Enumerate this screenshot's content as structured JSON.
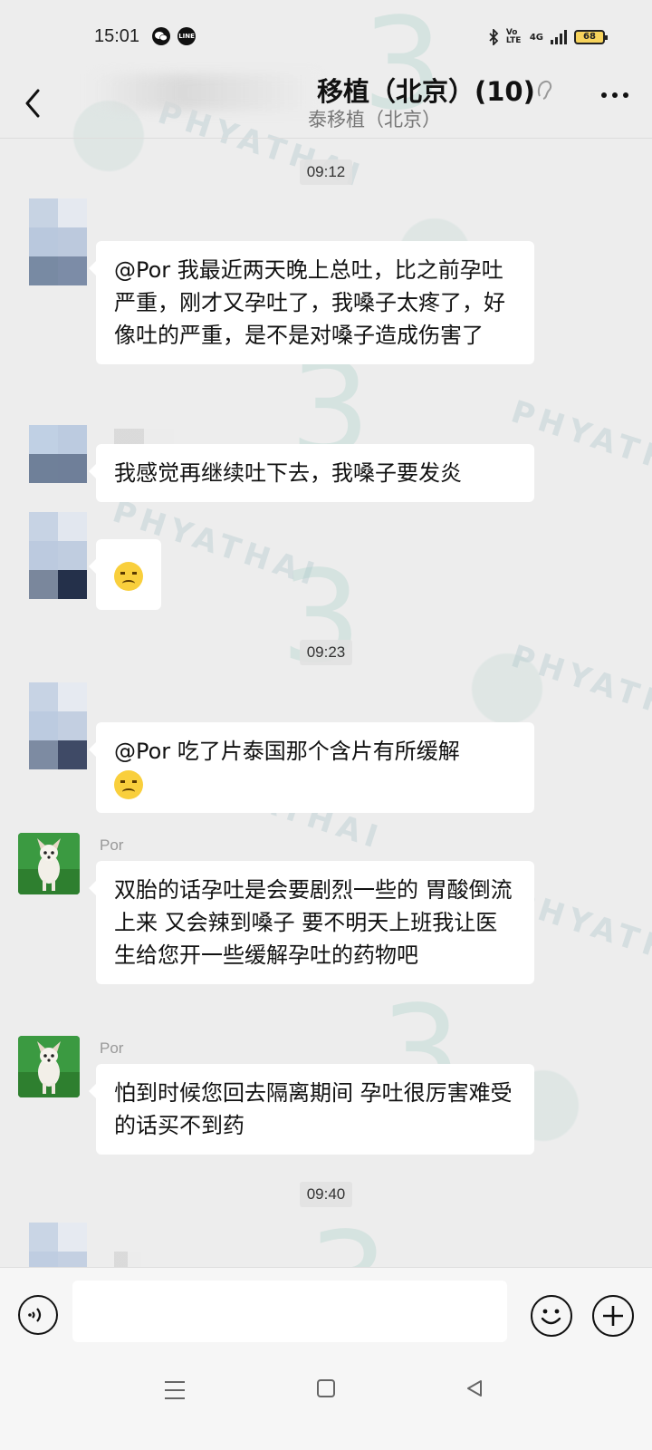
{
  "status_bar": {
    "time": "15:01",
    "app_icons": [
      "wechat-icon",
      "line-icon"
    ],
    "network": "4G",
    "volte": "Vo LTE",
    "battery": "68"
  },
  "header": {
    "title": "移植（北京）(10)",
    "subtitle": "泰移植（北京）"
  },
  "watermark": {
    "brand": "PHYATHAI",
    "digit": "3"
  },
  "messages": [
    {
      "type": "timestamp",
      "text": "09:12"
    },
    {
      "type": "incoming",
      "sender": "",
      "text": "@Por  我最近两天晚上总吐，比之前孕吐严重，刚才又孕吐了，我嗓子太疼了，好像吐的严重，是不是对嗓子造成伤害了",
      "emoji": false
    },
    {
      "type": "incoming",
      "sender": "",
      "text": "我感觉再继续吐下去，我嗓子要发炎",
      "emoji": false
    },
    {
      "type": "incoming",
      "sender": "",
      "text": "",
      "emoji": true,
      "emoji_name": "sad-cry-emoji"
    },
    {
      "type": "timestamp",
      "text": "09:23"
    },
    {
      "type": "incoming",
      "sender": "",
      "text": "@Por  吃了片泰国那个含片有所缓解",
      "emoji": true,
      "emoji_name": "sad-cry-emoji"
    },
    {
      "type": "incoming",
      "sender": "Por",
      "text": "双胎的话孕吐是会要剧烈一些的  胃酸倒流上来  又会辣到嗓子  要不明天上班我让医生给您开一些缓解孕吐的药物吧",
      "emoji": false
    },
    {
      "type": "incoming",
      "sender": "Por",
      "text": "怕到时候您回去隔离期间  孕吐很厉害难受的话买不到药",
      "emoji": false
    },
    {
      "type": "timestamp",
      "text": "09:40"
    }
  ],
  "input_bar": {
    "placeholder": ""
  }
}
